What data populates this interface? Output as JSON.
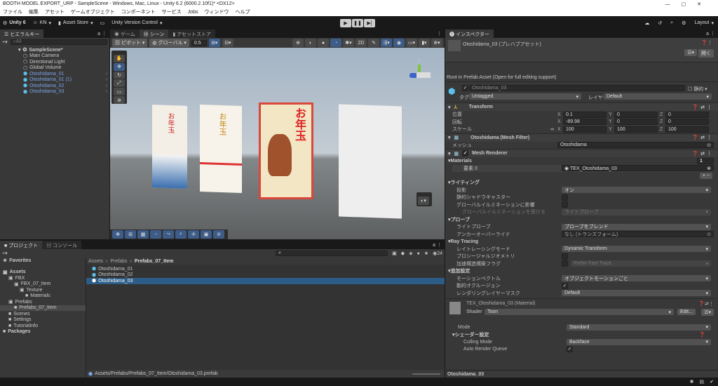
{
  "window": {
    "title": "BOOTH MODEL EXPORT_URP - SampleScene - Windows, Mac, Linux - Unity 6.2 (6000.2.10f1)* <DX12>"
  },
  "menu": [
    "ファイル",
    "編集",
    "アセット",
    "ゲームオブジェクト",
    "コンポーネント",
    "サービス",
    "Jobs",
    "ウィンドウ",
    "ヘルプ"
  ],
  "toolbar": {
    "unity": "Unity 6",
    "account": "KN",
    "asset_store": "Asset Store",
    "version_control": "Unity Version Control",
    "layout": "Layout"
  },
  "hierarchy": {
    "tab": "ヒエラルキー",
    "search_placeholder": "All",
    "scene": "SampleScene*",
    "items": [
      {
        "label": "Main Camera",
        "prefab": false
      },
      {
        "label": "Directional Light",
        "prefab": false
      },
      {
        "label": "Global Volume",
        "prefab": false
      },
      {
        "label": "Otoshidama_01",
        "prefab": true
      },
      {
        "label": "Otoshidama_01 (1)",
        "prefab": true
      },
      {
        "label": "Otoshidama_02",
        "prefab": true
      },
      {
        "label": "Otoshidama_03",
        "prefab": true
      }
    ]
  },
  "scene": {
    "tabs": [
      "ゲーム",
      "シーン",
      "アセットストア"
    ],
    "active_tab": 1,
    "pivot": "ピボット",
    "global": "グローバル",
    "snap": "0.5",
    "gizmo_axis": "y",
    "card_texts": [
      "お年玉",
      "お年玉",
      "お年玉"
    ]
  },
  "project": {
    "tabs": [
      "プロジェクト",
      "コンソール"
    ],
    "count": "24",
    "tree": [
      {
        "label": "Favorites",
        "depth": 0,
        "icon": "★"
      },
      {
        "label": "Assets",
        "depth": 0,
        "icon": "▣"
      },
      {
        "label": "FBX",
        "depth": 1,
        "icon": "▣"
      },
      {
        "label": "FBX_07_Item",
        "depth": 2,
        "icon": "▣"
      },
      {
        "label": "Texture",
        "depth": 3,
        "icon": "▣"
      },
      {
        "label": "Materials",
        "depth": 4,
        "icon": "■"
      },
      {
        "label": "Prefabs",
        "depth": 1,
        "icon": "▣"
      },
      {
        "label": "Prefabs_07_Item",
        "depth": 2,
        "icon": "■",
        "selected": true
      },
      {
        "label": "Scenes",
        "depth": 1,
        "icon": "■"
      },
      {
        "label": "Settings",
        "depth": 1,
        "icon": "■"
      },
      {
        "label": "TutorialInfo",
        "depth": 1,
        "icon": "■"
      },
      {
        "label": "Packages",
        "depth": 0,
        "icon": "■"
      }
    ],
    "breadcrumb": [
      "Assets",
      "Prefabs",
      "Prefabs_07_Item"
    ],
    "files": [
      "Otoshidama_01",
      "Otoshidama_02",
      "Otoshidama_03"
    ],
    "selected_file": 2,
    "footer_path": "Assets/Prefabs/Prefabs_07_Item/Otoshidama_03.prefab"
  },
  "inspector": {
    "tab": "インスペクター",
    "asset_title": "Otoshidama_03 (プレハブアセット)",
    "open_button": "開く",
    "root_note": "Root in Prefab Asset (Open for full editing support)",
    "name": "Otoshidama_03",
    "static": "静的",
    "tag_label": "タグ",
    "tag": "Untagged",
    "layer_label": "レイヤー",
    "layer": "Default",
    "transform": {
      "title": "Transform",
      "rows": [
        {
          "label": "位置",
          "x": "0.1",
          "y": "0",
          "z": "0"
        },
        {
          "label": "回転",
          "x": "-89.98",
          "y": "0",
          "z": "0"
        },
        {
          "label": "スケール",
          "x": "100",
          "y": "100",
          "z": "100"
        }
      ]
    },
    "mesh_filter": {
      "title": "Otoshidama (Mesh Filter)",
      "label": "メッシュ",
      "value": "Otoshidama"
    },
    "mesh_renderer": {
      "title": "Mesh Renderer",
      "materials_label": "Materials",
      "materials_count": "1",
      "element_label": "要素 0",
      "element_value": "TEX_Otoshidama_03",
      "lighting": "ライティング",
      "cast_shadows_label": "投影",
      "cast_shadows": "オン",
      "static_shadow": "静的シャドウキャスター",
      "gi_contrib": "グローバルイルミネーションに影響",
      "gi_receive_label": "グローバルイルミネーションを受ける",
      "gi_receive": "ライトプローブ",
      "probes": "プローブ",
      "light_probe_label": "ライトプローブ",
      "light_probe": "プローブをブレンド",
      "anchor_label": "アンカーオーバーライド",
      "anchor": "なし (トランスフォーム)",
      "ray_tracing": "Ray Tracing",
      "rt_mode_label": "レイトレーシングモード",
      "rt_mode": "Dynamic Transform",
      "procedural_label": "プロシージャルジオメトリ",
      "accel_label": "加速構造構築フラグ",
      "accel": "Prefer Fast Trace",
      "additional": "追加設定",
      "motion_label": "モーションベクトル",
      "motion": "オブジェクトモーションごと",
      "occlusion_label": "動的オクルージョン",
      "rl_mask_label": "レンダリングレイヤーマスク",
      "rl_mask": "Default"
    },
    "material": {
      "title": "TEX_Otoshidama_03 (Material)",
      "shader_label": "Shader",
      "shader": "Toon",
      "edit": "Edit...",
      "mode_label": "Mode",
      "mode": "Standard",
      "shader_settings": "シェーダー設定",
      "culling_label": "Culling Mode",
      "culling": "Backface",
      "queue_label": "Auto Render Queue"
    },
    "footer": "Otoshidama_03"
  },
  "colors": {
    "accent": "#3d5c88",
    "selected": "#2c5d87",
    "prefab_blue": "#7ba4e6"
  }
}
